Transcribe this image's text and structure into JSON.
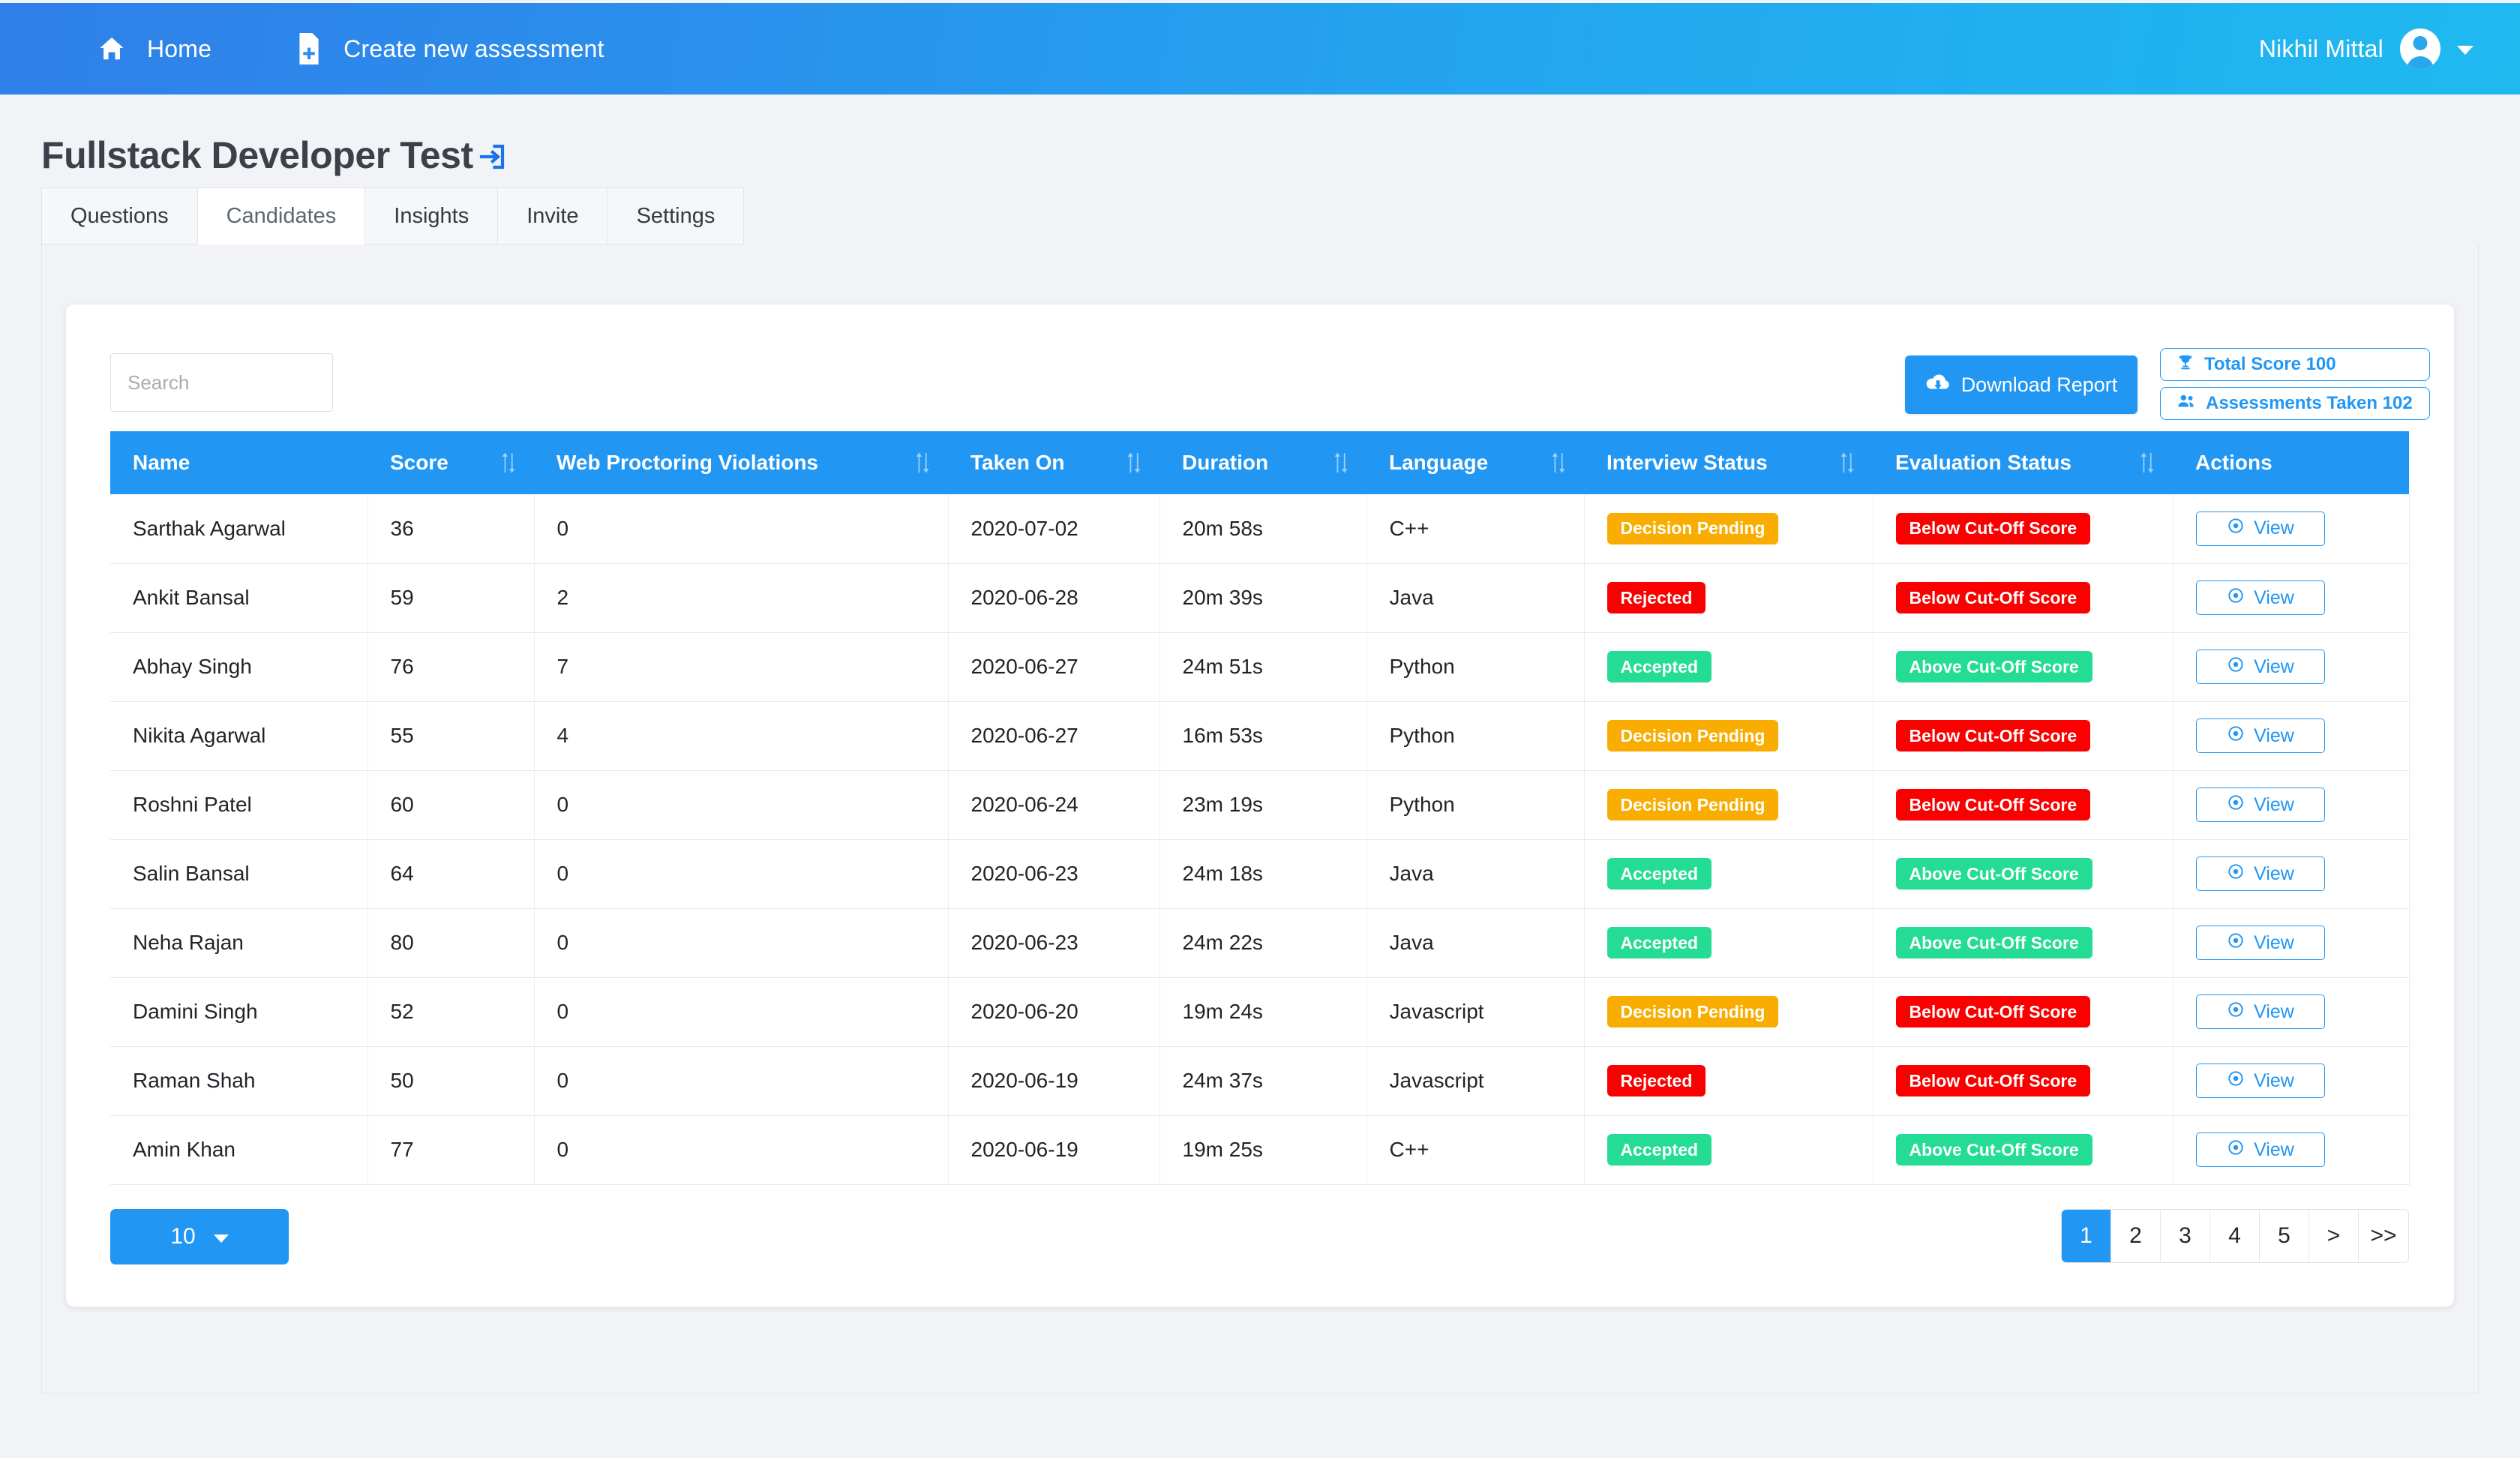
{
  "topbar": {
    "home_label": "Home",
    "create_label": "Create new assessment",
    "user_name": "Nikhil Mittal"
  },
  "page": {
    "title": "Fullstack Developer Test"
  },
  "tabs": [
    {
      "label": "Questions",
      "active": false
    },
    {
      "label": "Candidates",
      "active": true
    },
    {
      "label": "Insights",
      "active": false
    },
    {
      "label": "Invite",
      "active": false
    },
    {
      "label": "Settings",
      "active": false
    }
  ],
  "toolbar": {
    "search_placeholder": "Search",
    "search_value": "",
    "download_label": "Download Report",
    "total_score_label": "Total Score 100",
    "assessments_taken_label": "Assessments Taken 102"
  },
  "table": {
    "columns": [
      {
        "label": "Name",
        "sortable": false
      },
      {
        "label": "Score",
        "sortable": true
      },
      {
        "label": "Web Proctoring Violations",
        "sortable": true
      },
      {
        "label": "Taken On",
        "sortable": true
      },
      {
        "label": "Duration",
        "sortable": true
      },
      {
        "label": "Language",
        "sortable": true
      },
      {
        "label": "Interview Status",
        "sortable": true
      },
      {
        "label": "Evaluation Status",
        "sortable": true
      },
      {
        "label": "Actions",
        "sortable": false
      }
    ],
    "action_label": "View",
    "rows": [
      {
        "name": "Sarthak Agarwal",
        "score": "36",
        "violations": "0",
        "taken_on": "2020-07-02",
        "duration": "20m 58s",
        "language": "C++",
        "interview_status": "Decision Pending",
        "interview_class": "b-pending",
        "evaluation_status": "Below Cut-Off Score",
        "evaluation_class": "b-below"
      },
      {
        "name": "Ankit Bansal",
        "score": "59",
        "violations": "2",
        "taken_on": "2020-06-28",
        "duration": "20m 39s",
        "language": "Java",
        "interview_status": "Rejected",
        "interview_class": "b-rejected",
        "evaluation_status": "Below Cut-Off Score",
        "evaluation_class": "b-below"
      },
      {
        "name": "Abhay Singh",
        "score": "76",
        "violations": "7",
        "taken_on": "2020-06-27",
        "duration": "24m 51s",
        "language": "Python",
        "interview_status": "Accepted",
        "interview_class": "b-accepted",
        "evaluation_status": "Above Cut-Off Score",
        "evaluation_class": "b-above"
      },
      {
        "name": "Nikita Agarwal",
        "score": "55",
        "violations": "4",
        "taken_on": "2020-06-27",
        "duration": "16m 53s",
        "language": "Python",
        "interview_status": "Decision Pending",
        "interview_class": "b-pending",
        "evaluation_status": "Below Cut-Off Score",
        "evaluation_class": "b-below"
      },
      {
        "name": "Roshni Patel",
        "score": "60",
        "violations": "0",
        "taken_on": "2020-06-24",
        "duration": "23m 19s",
        "language": "Python",
        "interview_status": "Decision Pending",
        "interview_class": "b-pending",
        "evaluation_status": "Below Cut-Off Score",
        "evaluation_class": "b-below"
      },
      {
        "name": "Salin Bansal",
        "score": "64",
        "violations": "0",
        "taken_on": "2020-06-23",
        "duration": "24m 18s",
        "language": "Java",
        "interview_status": "Accepted",
        "interview_class": "b-accepted",
        "evaluation_status": "Above Cut-Off Score",
        "evaluation_class": "b-above"
      },
      {
        "name": "Neha Rajan",
        "score": "80",
        "violations": "0",
        "taken_on": "2020-06-23",
        "duration": "24m 22s",
        "language": "Java",
        "interview_status": "Accepted",
        "interview_class": "b-accepted",
        "evaluation_status": "Above Cut-Off Score",
        "evaluation_class": "b-above"
      },
      {
        "name": "Damini Singh",
        "score": "52",
        "violations": "0",
        "taken_on": "2020-06-20",
        "duration": "19m 24s",
        "language": "Javascript",
        "interview_status": "Decision Pending",
        "interview_class": "b-pending",
        "evaluation_status": "Below Cut-Off Score",
        "evaluation_class": "b-below"
      },
      {
        "name": "Raman Shah",
        "score": "50",
        "violations": "0",
        "taken_on": "2020-06-19",
        "duration": "24m 37s",
        "language": "Javascript",
        "interview_status": "Rejected",
        "interview_class": "b-rejected",
        "evaluation_status": "Below Cut-Off Score",
        "evaluation_class": "b-below"
      },
      {
        "name": "Amin Khan",
        "score": "77",
        "violations": "0",
        "taken_on": "2020-06-19",
        "duration": "19m 25s",
        "language": "C++",
        "interview_status": "Accepted",
        "interview_class": "b-accepted",
        "evaluation_status": "Above Cut-Off Score",
        "evaluation_class": "b-above"
      }
    ]
  },
  "footer": {
    "page_size": "10",
    "pages": [
      {
        "label": "1",
        "active": true
      },
      {
        "label": "2",
        "active": false
      },
      {
        "label": "3",
        "active": false
      },
      {
        "label": "4",
        "active": false
      },
      {
        "label": "5",
        "active": false
      },
      {
        "label": ">",
        "active": false
      },
      {
        "label": ">>",
        "active": false
      }
    ]
  },
  "colors": {
    "brand_blue": "#2196f3",
    "header_gradient_start": "#2f7fe8",
    "header_gradient_end": "#1fb9f0",
    "pending": "#f8ad00",
    "rejected": "#fa0000",
    "accepted": "#24dc94",
    "page_bg": "#f1f3f6"
  }
}
